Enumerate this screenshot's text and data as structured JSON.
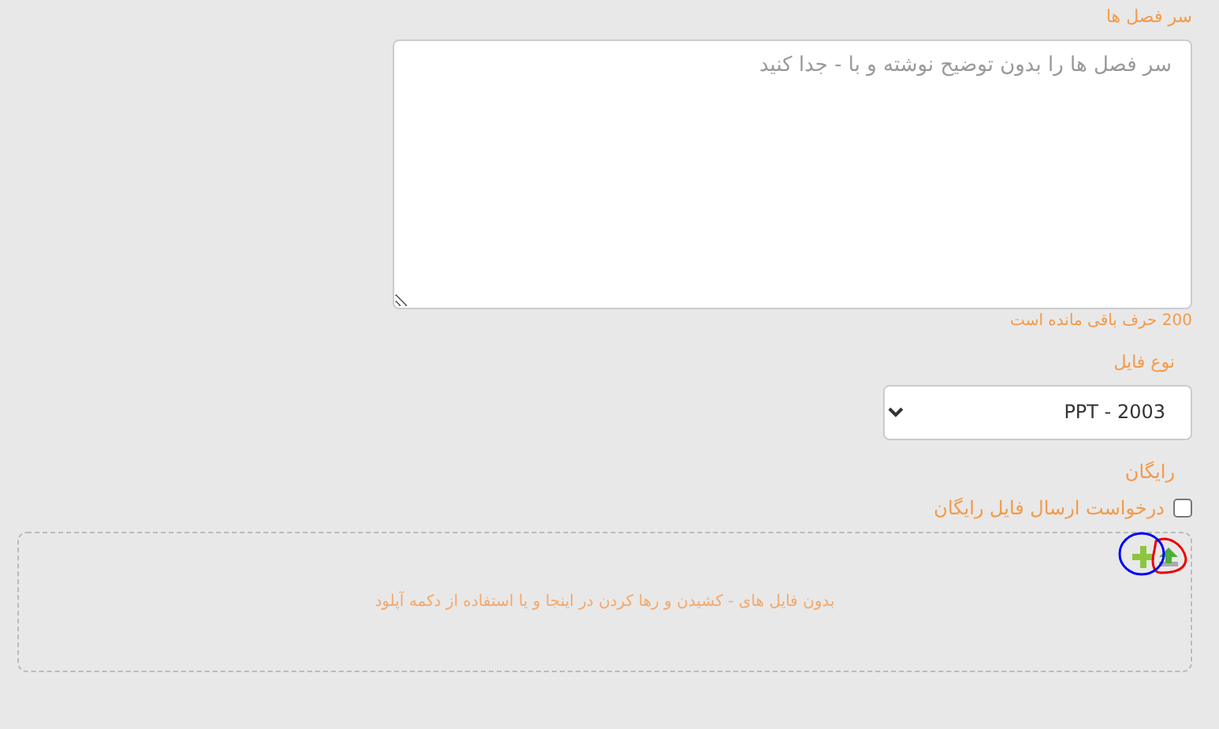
{
  "headings_label": "سر فصل ها",
  "headings_field": {
    "placeholder": "سر فصل ها را بدون توضیح نوشته و با - جدا کنید"
  },
  "char_counter": {
    "count": "200",
    "text": "حرف باقی مانده است"
  },
  "file_type": {
    "label": "نوع فایل",
    "value": "PPT - 2003"
  },
  "free_label": "رایگان",
  "free_request": {
    "label": "درخواست ارسال فایل رایگان",
    "checked": false
  },
  "dropzone": {
    "message": "بدون فایل های - کشیدن و رها کردن در اینجا و یا استفاده از دکمه آپلود"
  }
}
